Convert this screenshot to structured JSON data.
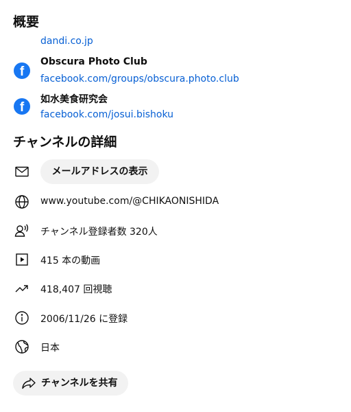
{
  "about": {
    "title": "概要",
    "cut_link": "dandi.co.jp",
    "links": [
      {
        "icon": "facebook-icon",
        "title": "Obscura Photo Club",
        "url": "facebook.com/groups/obscura.photo.club"
      },
      {
        "icon": "facebook-icon",
        "title": "如水美食研究会",
        "url": "facebook.com/josui.bishoku"
      }
    ]
  },
  "details": {
    "title": "チャンネルの詳細",
    "email_button": "メールアドレスの表示",
    "url": "www.youtube.com/@CHIKAONISHIDA",
    "subscribers": "チャンネル登録者数 320人",
    "videos": "415 本の動画",
    "views": "418,407 回視聴",
    "joined": "2006/11/26 に登録",
    "country": "日本"
  },
  "share_button": "チャンネルを共有",
  "colors": {
    "link": "#065fd4",
    "facebook": "#1877f2",
    "pill_bg": "#f2f2f2"
  }
}
